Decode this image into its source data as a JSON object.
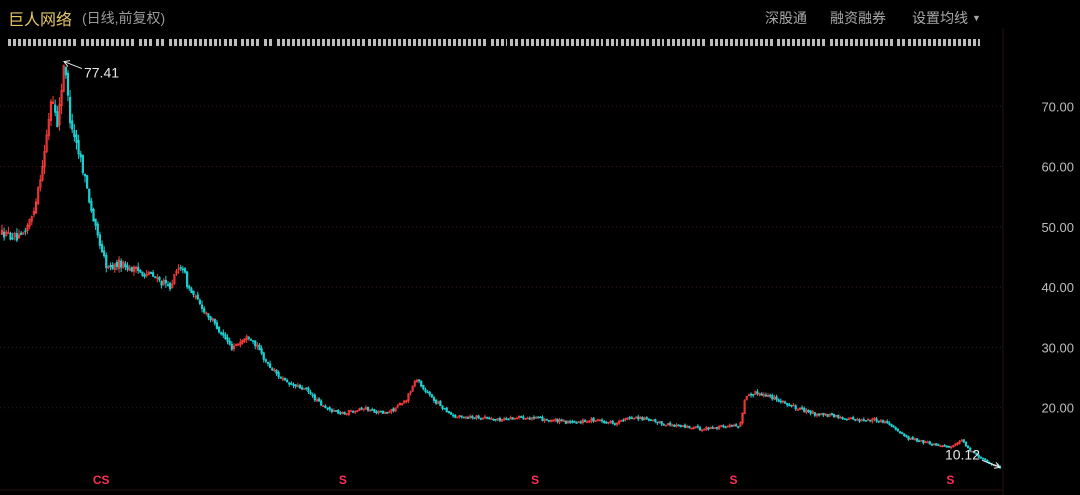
{
  "header": {
    "title": "巨人网络",
    "subtitle": "(日线,前复权)",
    "buttons": {
      "sgt": "深股通",
      "rzrq": "融资融券",
      "szjx": "设置均线"
    }
  },
  "chart_data": {
    "type": "candlestick",
    "ylim": [
      10,
      79
    ],
    "yticks": [
      20,
      30,
      40,
      50,
      60,
      70
    ],
    "ytick_labels": [
      "20.00",
      "30.00",
      "40.00",
      "50.00",
      "60.00",
      "70.00"
    ],
    "grid": true,
    "colors": {
      "up": "#ff3b3b",
      "down": "#1ed1d1",
      "grid": "#3a1a1a",
      "label": "#bdbdbd",
      "marker": "#ff2d55"
    },
    "price_path": [
      [
        0,
        49
      ],
      [
        3,
        48
      ],
      [
        5,
        52
      ],
      [
        7,
        63
      ],
      [
        8,
        72
      ],
      [
        9,
        67
      ],
      [
        10,
        77.41
      ],
      [
        11,
        68
      ],
      [
        13,
        60
      ],
      [
        15,
        50
      ],
      [
        17,
        43
      ],
      [
        19,
        44
      ],
      [
        21,
        43
      ],
      [
        24,
        42
      ],
      [
        27,
        40
      ],
      [
        29,
        44
      ],
      [
        30,
        40
      ],
      [
        32,
        37
      ],
      [
        35,
        33
      ],
      [
        37,
        30
      ],
      [
        40,
        32
      ],
      [
        43,
        27
      ],
      [
        46,
        24
      ],
      [
        49,
        23
      ],
      [
        52,
        20
      ],
      [
        55,
        19
      ],
      [
        58,
        20
      ],
      [
        62,
        19
      ],
      [
        65,
        21
      ],
      [
        67,
        25
      ],
      [
        68,
        23
      ],
      [
        70,
        21
      ],
      [
        73,
        18.5
      ],
      [
        77,
        18.5
      ],
      [
        80,
        18
      ],
      [
        84,
        18.5
      ],
      [
        88,
        18
      ],
      [
        92,
        17.5
      ],
      [
        95,
        18
      ],
      [
        99,
        17.5
      ],
      [
        102,
        18.5
      ],
      [
        106,
        17.5
      ],
      [
        109,
        17
      ],
      [
        113,
        16.5
      ],
      [
        117,
        17
      ],
      [
        119,
        17
      ],
      [
        120,
        22
      ],
      [
        122,
        22.5
      ],
      [
        125,
        21.5
      ],
      [
        128,
        20
      ],
      [
        131,
        19
      ],
      [
        135,
        18.5
      ],
      [
        138,
        18
      ],
      [
        141,
        18
      ],
      [
        143,
        17.5
      ],
      [
        146,
        15
      ],
      [
        150,
        14
      ],
      [
        153,
        13.5
      ],
      [
        155,
        14.5
      ],
      [
        156,
        13
      ],
      [
        159,
        11
      ],
      [
        161,
        10.12
      ]
    ],
    "annotations": [
      {
        "label": "77.41",
        "value": 77.41,
        "position": "peak"
      },
      {
        "label": "10.12",
        "value": 10.12,
        "position": "low"
      }
    ],
    "event_markers": [
      {
        "label": "CS",
        "index": 16
      },
      {
        "label": "S",
        "index": 55
      },
      {
        "label": "S",
        "index": 86
      },
      {
        "label": "S",
        "index": 118
      },
      {
        "label": "S",
        "index": 153
      }
    ]
  }
}
